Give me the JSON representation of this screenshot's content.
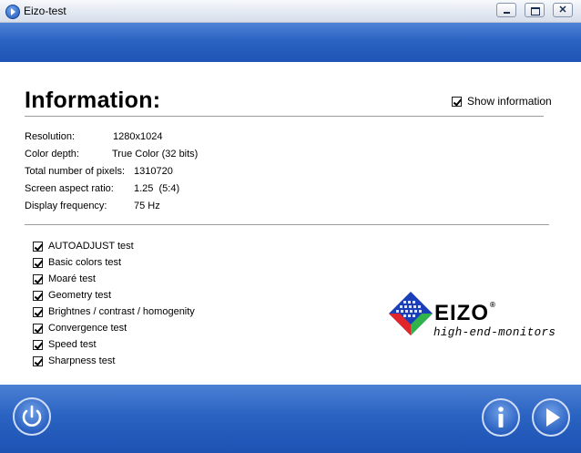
{
  "window": {
    "title": "Eizo-test"
  },
  "heading": "Information:",
  "show_information": {
    "label": "Show information",
    "checked": true
  },
  "info": {
    "resolution": {
      "label": "Resolution:",
      "value": "1280x1024"
    },
    "color_depth": {
      "label": "Color depth:",
      "value": "True Color (32 bits)"
    },
    "total_pixels": {
      "label": "Total number of pixels:",
      "value": "1310720"
    },
    "aspect_ratio": {
      "label": "Screen aspect ratio:",
      "value": "1.25  (5:4)"
    },
    "frequency": {
      "label": "Display frequency:",
      "value": "75 Hz"
    }
  },
  "tests": [
    {
      "label": "AUTOADJUST test",
      "checked": true
    },
    {
      "label": "Basic colors test",
      "checked": true
    },
    {
      "label": "Moaré test",
      "checked": true
    },
    {
      "label": "Geometry test",
      "checked": true
    },
    {
      "label": "Brightnes / contrast / homogenity",
      "checked": true
    },
    {
      "label": "Convergence test",
      "checked": true
    },
    {
      "label": "Speed test",
      "checked": true
    },
    {
      "label": "Sharpness test",
      "checked": true
    }
  ],
  "logo": {
    "brand": "EIZO",
    "tagline": "high-end-monitors"
  },
  "icons": {
    "app": "app-play-icon",
    "power": "power-icon",
    "info": "info-icon",
    "play": "play-icon"
  },
  "colors": {
    "band_blue": "#2a63c2",
    "button_ring": "#cfdcf5"
  }
}
